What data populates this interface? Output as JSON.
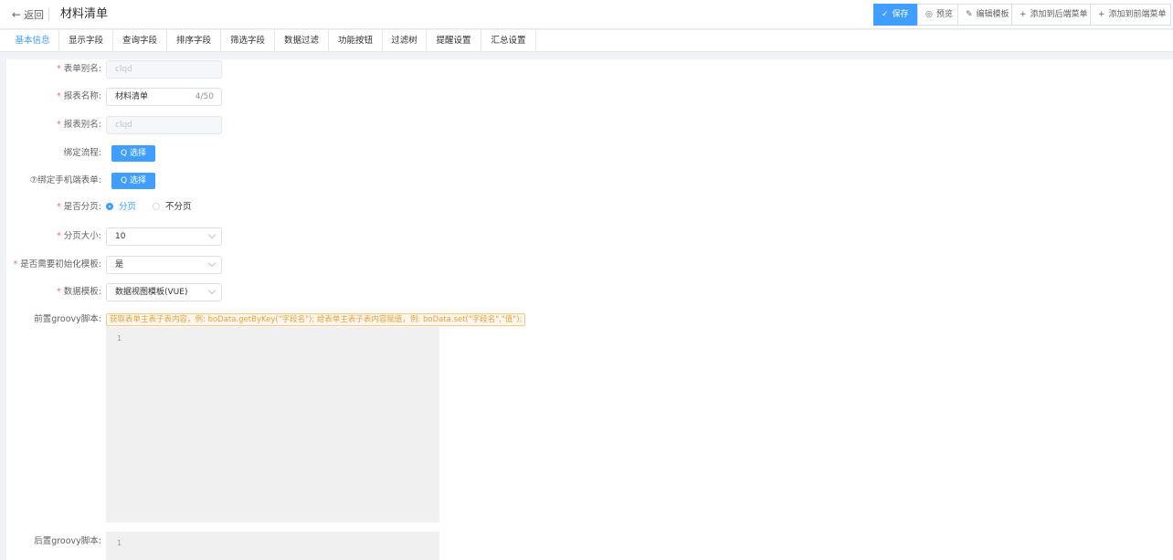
{
  "header": {
    "back_label": "返回",
    "title": "材料清单",
    "toolbar": {
      "save": "保存",
      "preview": "预览",
      "edit_template": "编辑模板",
      "add_backend_menu": "添加到后端菜单",
      "add_frontend_menu": "添加到前端菜单"
    }
  },
  "tabs": [
    "基本信息",
    "显示字段",
    "查询字段",
    "排序字段",
    "筛选字段",
    "数据过滤",
    "功能按钮",
    "过滤树",
    "提醒设置",
    "汇总设置"
  ],
  "active_tab": 0,
  "form": {
    "form_alias": {
      "label": "表单别名:",
      "value": "clqd",
      "required": true
    },
    "report_name": {
      "label": "报表名称:",
      "value": "材料清单",
      "count": "4/50",
      "required": true
    },
    "report_alias": {
      "label": "报表别名:",
      "value": "clqd",
      "required": true
    },
    "bind_flow": {
      "label": "绑定流程:",
      "button": "选择"
    },
    "bind_mobile_form": {
      "label": "⑦绑定手机端表单:",
      "button": "选择"
    },
    "paging": {
      "label": "是否分页:",
      "options": [
        "分页",
        "不分页"
      ],
      "selected": 0,
      "required": true
    },
    "page_size": {
      "label": "分页大小:",
      "value": "10",
      "required": true
    },
    "init_template": {
      "label": "是否需要初始化模板:",
      "value": "是",
      "required": true
    },
    "data_template": {
      "label": "数据模板:",
      "value": "数据视图模板(VUE)",
      "required": true
    },
    "pre_script": {
      "label": "前置groovy脚本:",
      "hint": "获取表单主表子表内容，例: boData.getByKey(\"字段名\"); 给表单主表子表内容赋值，例: boData.set(\"字段名\",\"值\");",
      "line_no": "1"
    },
    "post_script": {
      "label": "后置groovy脚本:",
      "line_no": "1"
    }
  },
  "colors": {
    "primary": "#409eff",
    "required": "#f56c6c",
    "hint_text": "#e6a23c"
  }
}
